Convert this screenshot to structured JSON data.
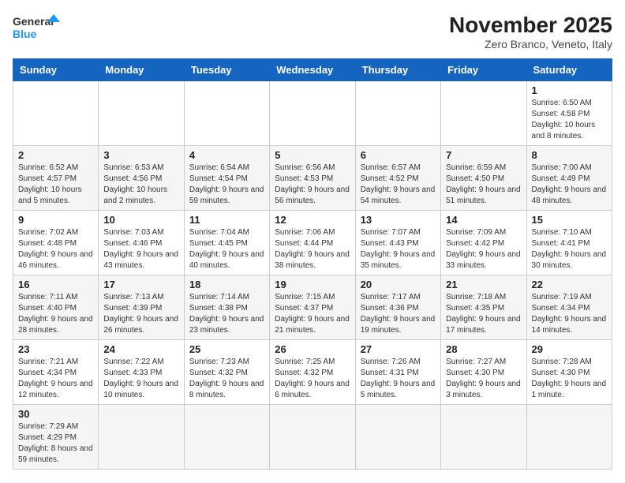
{
  "header": {
    "logo_general": "General",
    "logo_blue": "Blue",
    "month_year": "November 2025",
    "location": "Zero Branco, Veneto, Italy"
  },
  "days_of_week": [
    "Sunday",
    "Monday",
    "Tuesday",
    "Wednesday",
    "Thursday",
    "Friday",
    "Saturday"
  ],
  "weeks": [
    [
      {
        "day": "",
        "info": ""
      },
      {
        "day": "",
        "info": ""
      },
      {
        "day": "",
        "info": ""
      },
      {
        "day": "",
        "info": ""
      },
      {
        "day": "",
        "info": ""
      },
      {
        "day": "",
        "info": ""
      },
      {
        "day": "1",
        "info": "Sunrise: 6:50 AM\nSunset: 4:58 PM\nDaylight: 10 hours and 8 minutes."
      }
    ],
    [
      {
        "day": "2",
        "info": "Sunrise: 6:52 AM\nSunset: 4:57 PM\nDaylight: 10 hours and 5 minutes."
      },
      {
        "day": "3",
        "info": "Sunrise: 6:53 AM\nSunset: 4:56 PM\nDaylight: 10 hours and 2 minutes."
      },
      {
        "day": "4",
        "info": "Sunrise: 6:54 AM\nSunset: 4:54 PM\nDaylight: 9 hours and 59 minutes."
      },
      {
        "day": "5",
        "info": "Sunrise: 6:56 AM\nSunset: 4:53 PM\nDaylight: 9 hours and 56 minutes."
      },
      {
        "day": "6",
        "info": "Sunrise: 6:57 AM\nSunset: 4:52 PM\nDaylight: 9 hours and 54 minutes."
      },
      {
        "day": "7",
        "info": "Sunrise: 6:59 AM\nSunset: 4:50 PM\nDaylight: 9 hours and 51 minutes."
      },
      {
        "day": "8",
        "info": "Sunrise: 7:00 AM\nSunset: 4:49 PM\nDaylight: 9 hours and 48 minutes."
      }
    ],
    [
      {
        "day": "9",
        "info": "Sunrise: 7:02 AM\nSunset: 4:48 PM\nDaylight: 9 hours and 46 minutes."
      },
      {
        "day": "10",
        "info": "Sunrise: 7:03 AM\nSunset: 4:46 PM\nDaylight: 9 hours and 43 minutes."
      },
      {
        "day": "11",
        "info": "Sunrise: 7:04 AM\nSunset: 4:45 PM\nDaylight: 9 hours and 40 minutes."
      },
      {
        "day": "12",
        "info": "Sunrise: 7:06 AM\nSunset: 4:44 PM\nDaylight: 9 hours and 38 minutes."
      },
      {
        "day": "13",
        "info": "Sunrise: 7:07 AM\nSunset: 4:43 PM\nDaylight: 9 hours and 35 minutes."
      },
      {
        "day": "14",
        "info": "Sunrise: 7:09 AM\nSunset: 4:42 PM\nDaylight: 9 hours and 33 minutes."
      },
      {
        "day": "15",
        "info": "Sunrise: 7:10 AM\nSunset: 4:41 PM\nDaylight: 9 hours and 30 minutes."
      }
    ],
    [
      {
        "day": "16",
        "info": "Sunrise: 7:11 AM\nSunset: 4:40 PM\nDaylight: 9 hours and 28 minutes."
      },
      {
        "day": "17",
        "info": "Sunrise: 7:13 AM\nSunset: 4:39 PM\nDaylight: 9 hours and 26 minutes."
      },
      {
        "day": "18",
        "info": "Sunrise: 7:14 AM\nSunset: 4:38 PM\nDaylight: 9 hours and 23 minutes."
      },
      {
        "day": "19",
        "info": "Sunrise: 7:15 AM\nSunset: 4:37 PM\nDaylight: 9 hours and 21 minutes."
      },
      {
        "day": "20",
        "info": "Sunrise: 7:17 AM\nSunset: 4:36 PM\nDaylight: 9 hours and 19 minutes."
      },
      {
        "day": "21",
        "info": "Sunrise: 7:18 AM\nSunset: 4:35 PM\nDaylight: 9 hours and 17 minutes."
      },
      {
        "day": "22",
        "info": "Sunrise: 7:19 AM\nSunset: 4:34 PM\nDaylight: 9 hours and 14 minutes."
      }
    ],
    [
      {
        "day": "23",
        "info": "Sunrise: 7:21 AM\nSunset: 4:34 PM\nDaylight: 9 hours and 12 minutes."
      },
      {
        "day": "24",
        "info": "Sunrise: 7:22 AM\nSunset: 4:33 PM\nDaylight: 9 hours and 10 minutes."
      },
      {
        "day": "25",
        "info": "Sunrise: 7:23 AM\nSunset: 4:32 PM\nDaylight: 9 hours and 8 minutes."
      },
      {
        "day": "26",
        "info": "Sunrise: 7:25 AM\nSunset: 4:32 PM\nDaylight: 9 hours and 6 minutes."
      },
      {
        "day": "27",
        "info": "Sunrise: 7:26 AM\nSunset: 4:31 PM\nDaylight: 9 hours and 5 minutes."
      },
      {
        "day": "28",
        "info": "Sunrise: 7:27 AM\nSunset: 4:30 PM\nDaylight: 9 hours and 3 minutes."
      },
      {
        "day": "29",
        "info": "Sunrise: 7:28 AM\nSunset: 4:30 PM\nDaylight: 9 hours and 1 minute."
      }
    ],
    [
      {
        "day": "30",
        "info": "Sunrise: 7:29 AM\nSunset: 4:29 PM\nDaylight: 8 hours and 59 minutes."
      },
      {
        "day": "",
        "info": ""
      },
      {
        "day": "",
        "info": ""
      },
      {
        "day": "",
        "info": ""
      },
      {
        "day": "",
        "info": ""
      },
      {
        "day": "",
        "info": ""
      },
      {
        "day": "",
        "info": ""
      }
    ]
  ]
}
